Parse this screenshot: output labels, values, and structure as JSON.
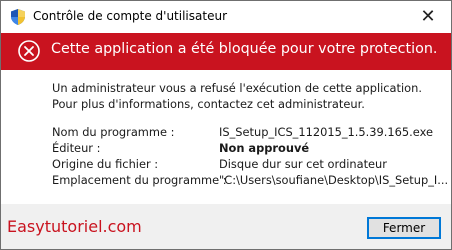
{
  "window": {
    "title": "Contrôle de compte d'utilisateur",
    "close_glyph": "✕"
  },
  "banner": {
    "text": "Cette application a été bloquée pour votre protection.",
    "color": "#c9131f"
  },
  "message": "Un administrateur vous a refusé l'exécution de cette application. Pour plus d'informations, contactez cet administrateur.",
  "details": [
    {
      "label": "Nom du programme :",
      "value": "IS_Setup_ICS_112015_1.5.39.165.exe",
      "bold": false
    },
    {
      "label": "Éditeur :",
      "value": "Non approuvé",
      "bold": true
    },
    {
      "label": "Origine du fichier :",
      "value": "Disque dur sur cet ordinateur",
      "bold": false
    },
    {
      "label": "Emplacement du programme :",
      "value": "\"C:\\Users\\soufiane\\Desktop\\IS_Setup_I...",
      "bold": false
    }
  ],
  "footer": {
    "watermark": "Easytutoriel.com",
    "close_button": "Fermer"
  }
}
